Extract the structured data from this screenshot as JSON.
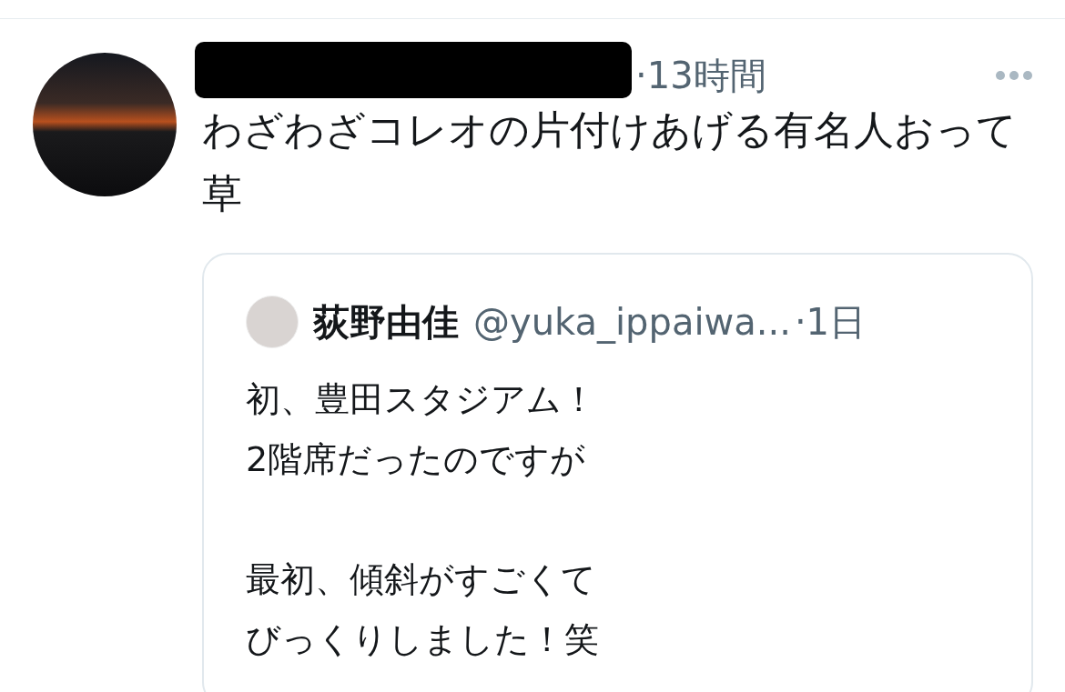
{
  "tweet": {
    "time": "·13時間",
    "text": "わざわざコレオの片付けあげる有名人おって草"
  },
  "quoted_tweet": {
    "name": "荻野由佳",
    "handle": "@yuka_ippaiwa...",
    "time": "·1日",
    "paragraphs": [
      [
        "初、豊田スタジアム！",
        "2階席だったのですが"
      ],
      [
        "最初、傾斜がすごくて",
        "びっくりしました！笑"
      ]
    ]
  }
}
